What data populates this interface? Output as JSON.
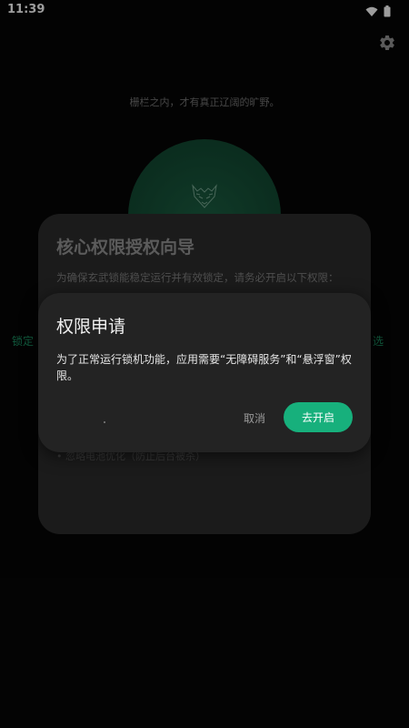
{
  "status_bar": {
    "time": "11:39",
    "icons": [
      "wifi-icon",
      "battery-icon"
    ]
  },
  "header": {
    "settings_icon": "gear-icon"
  },
  "main": {
    "tagline": "栅栏之内，才有真正辽阔的旷野。",
    "lock_emblem_icon": "tiger-emblem-icon",
    "side_left_text": "锁定",
    "side_right_text": "选"
  },
  "wizard_dialog": {
    "title": "核心权限授权向导",
    "description": "为确保玄武锁能稳定运行并有效锁定，请务必开启以下权限：",
    "item": "• 忽略电池优化（防止后台被杀）"
  },
  "permission_dialog": {
    "title": "权限申请",
    "message": "为了正常运行锁机功能，应用需要“无障碍服务”和“悬浮窗”权限。",
    "cancel_label": "取消",
    "confirm_label": "去开启"
  },
  "colors": {
    "accent": "#17b07c",
    "circle": "#134a33",
    "dialog_bg": "#232323",
    "background": "#060606"
  }
}
